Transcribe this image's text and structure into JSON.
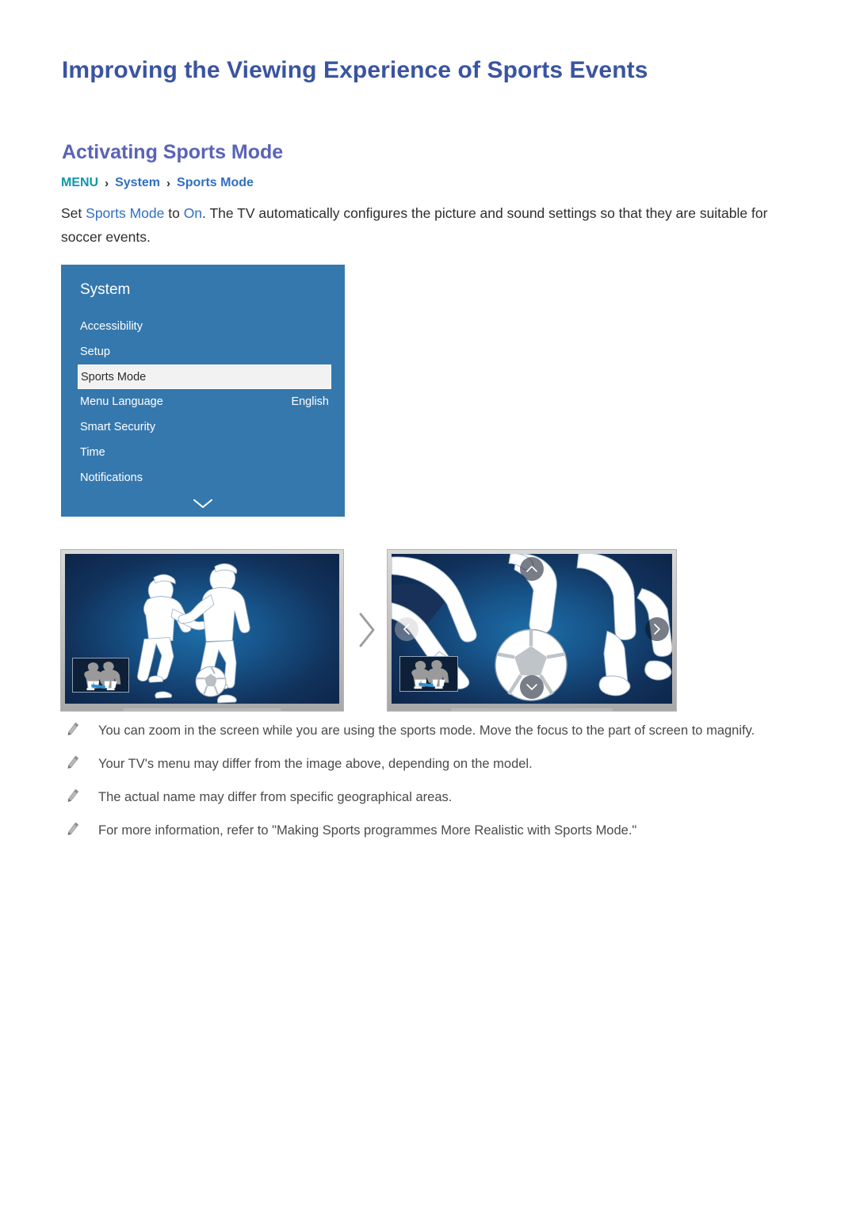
{
  "page_title": "Improving the Viewing Experience of Sports Events",
  "section": {
    "title": "Activating Sports Mode",
    "breadcrumb": {
      "menu": "MENU",
      "sep1": "›",
      "system": "System",
      "sep2": "›",
      "sports_mode": "Sports Mode"
    },
    "paragraph": {
      "part1": "Set ",
      "hl1": "Sports Mode",
      "part2": " to ",
      "hl2": "On",
      "part3": ". The TV automatically configures the picture and sound settings so that they are suitable for soccer events."
    }
  },
  "tv_menu": {
    "heading": "System",
    "items": [
      {
        "label": "Accessibility",
        "value": "",
        "selected": false
      },
      {
        "label": "Setup",
        "value": "",
        "selected": false
      },
      {
        "label": "Sports Mode",
        "value": "",
        "selected": true
      },
      {
        "label": "Menu Language",
        "value": "English",
        "selected": false
      },
      {
        "label": "Smart Security",
        "value": "",
        "selected": false
      },
      {
        "label": "Time",
        "value": "",
        "selected": false
      },
      {
        "label": "Notifications",
        "value": "",
        "selected": false
      }
    ],
    "more_indicator": "chevron-down",
    "panel_color": "#3578ae",
    "selected_row_color": "#f2f2f2"
  },
  "figures": {
    "tv_normal": {
      "caption": "",
      "content": "soccer-players-full-view",
      "pip": "player-thumbnail"
    },
    "transition_icon": "chevron-right",
    "tv_zoomed": {
      "caption": "",
      "content": "soccer-players-zoomed-view",
      "pip": "player-thumbnail",
      "nav_buttons": [
        "up",
        "down",
        "left",
        "right"
      ]
    }
  },
  "notes": [
    "You can zoom in the screen while you are using the sports mode. Move the focus to the part of screen to magnify.",
    "Your TV's menu may differ from the image above, depending on the model.",
    "The actual name may differ from specific geographical areas.",
    "For more information, refer to \"Making Sports programmes More Realistic with Sports Mode.\""
  ],
  "colors": {
    "title_blue": "#3a54a0",
    "section_purple": "#5a63b8",
    "menu_teal": "#0f97ab",
    "link_blue": "#2f6fc0",
    "panel_blue": "#3578ae",
    "note_gray": "#4a4a4a"
  }
}
